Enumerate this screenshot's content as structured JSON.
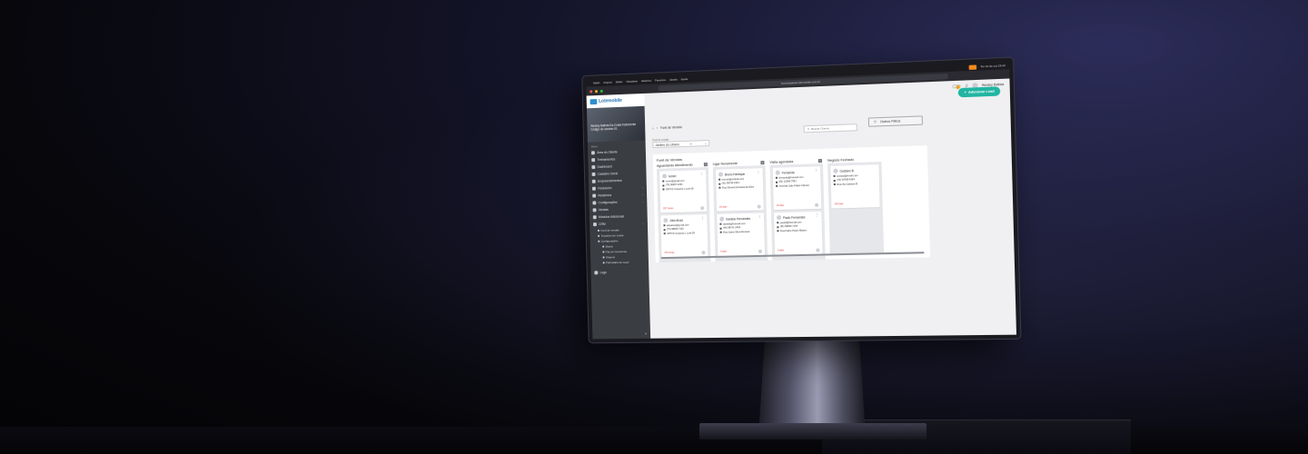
{
  "menubar": {
    "items": [
      "Safari",
      "Arquivo",
      "Editar",
      "Visualizar",
      "Histórico",
      "Favoritos",
      "Janela",
      "Ajuda"
    ],
    "clock": "Ter 14 de out 19:42"
  },
  "browser": {
    "url": "homologacao.lotemobile.com.br"
  },
  "app": {
    "logo": "Lotemobile",
    "add_lead": "Adicionar Lead",
    "user": "Wesley Batista"
  },
  "profile": {
    "name": "Wesley Batista Da Costa Felizmente",
    "subtitle": "Código do usuário 01"
  },
  "sidebar": {
    "menu_label": "Menu",
    "items": [
      "Área do Cliente",
      "Treinamentos",
      "Dashboard",
      "Cadastro Geral",
      "Empreendimentos",
      "Financeiro",
      "Relatórios",
      "Configurações",
      "Vendas",
      "Módulos Adicionais",
      "CRM"
    ],
    "crm_sub": [
      "Funil de vendas",
      "Transferir de Leads",
      "Configurações"
    ],
    "config_sub": [
      "Status",
      "Fila de Corretores",
      "Origens",
      "Formulário de Lead"
    ],
    "logout": "Logo"
  },
  "page": {
    "breadcrumb": "Funil de Vendas",
    "funnel_label": "Funil de vendas",
    "funnel_value": "Jardins do Líbano",
    "search_placeholder": "Buscar Cliente",
    "filters": "Outros Filtros",
    "board_title": "Funil de Vendas"
  },
  "columns": [
    {
      "title": "Aguardando Atendimento",
      "count": "2",
      "cards": [
        {
          "name": "Ivoneí",
          "email": "ivoneí@gmail.com",
          "phone": "(79) 98487-1261",
          "address": "SRTVS Conjunto L Lote 08",
          "time": "267 horas"
        },
        {
          "name": "Júlio Alves",
          "email": "julioalves@gmail.com",
          "phone": "(79) 98845-7152",
          "address": "SRTVS Conjunto L Lote 08",
          "time": "273 horas"
        }
      ]
    },
    {
      "title": "Ligar Novamente",
      "count": "2",
      "cards": [
        {
          "name": "Bruno Henrique",
          "email": "brunoh@outlook.com",
          "phone": "(41) 98745-3324",
          "address": "Rua Oliveira Doniseta da Silva",
          "time": "10 dias"
        },
        {
          "name": "Daniela Fernandes",
          "email": "daniela@hotmail.com",
          "phone": "(49) 98741-2469",
          "address": "Rua Joana Silva Monteiro",
          "time": "5 dias"
        }
      ]
    },
    {
      "title": "Visita agendada",
      "count": "2",
      "cards": [
        {
          "name": "Fernanda",
          "email": "fernanda@hotmail.com",
          "phone": "(81) 21566-7651",
          "address": "Avenida João Felipe Calmon",
          "time": "16 dias"
        },
        {
          "name": "Paulo Fernandes",
          "email": "paulof@hotmail.com",
          "phone": "(81) 99846-7154",
          "address": "Rua Padre Pedro Ribeiro",
          "time": "9 dias"
        }
      ]
    },
    {
      "title": "Negócio Fechado",
      "count": "",
      "cards": [
        {
          "name": "Gustavo B",
          "email": "contato@email.com",
          "phone": "(76) 94768-4284",
          "address": "Rua Via Caetano B",
          "time": "126 dias"
        }
      ]
    }
  ],
  "colors": {
    "accent": "#21b5a2",
    "sidebar": "#3a3d42",
    "danger": "#e0403a"
  }
}
